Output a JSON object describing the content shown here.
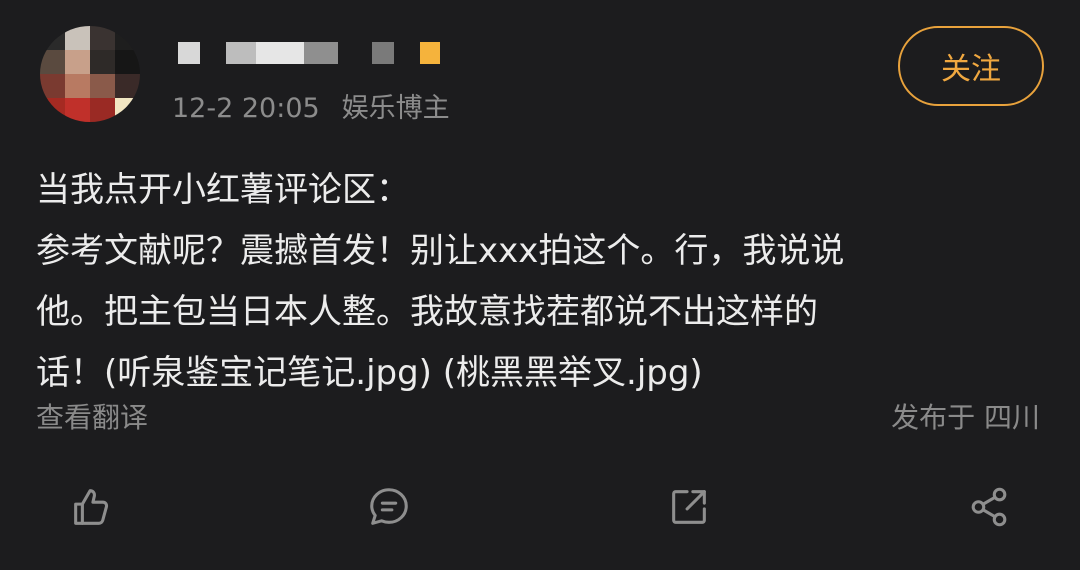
{
  "header": {
    "time": "12-2 20:05",
    "role": "娱乐博主",
    "follow_label": "关注"
  },
  "post": {
    "text": "当我点开小红薯评论区：\n参考文献呢？震撼首发！别让xxx拍这个。行，我说说\n他。把主包当日本人整。我故意找茬都说不出这样的\n话！(听泉鉴宝记笔记.jpg) (桃黑黑举叉.jpg)",
    "translate_label": "查看翻译",
    "location_label": "发布于 四川"
  },
  "actions": {
    "like_icon": "thumbs-up-icon",
    "comment_icon": "comment-icon",
    "repost_icon": "repost-icon",
    "share_icon": "share-icon"
  },
  "colors": {
    "background": "#1c1c1e",
    "accent": "#e8a23c",
    "text": "#ececec",
    "muted": "#8a8a8a"
  }
}
